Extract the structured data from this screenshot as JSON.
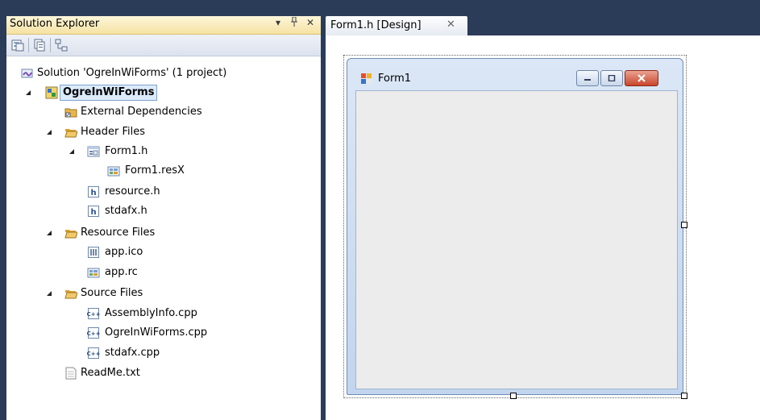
{
  "solution_explorer": {
    "title": "Solution Explorer",
    "title_buttons": [
      "▾",
      "ᵖ",
      "✕"
    ],
    "toolbar": [
      {
        "icon": "properties-icon"
      },
      {
        "icon": "show-all-files-icon"
      },
      {
        "icon": "view-class-diagram-icon"
      }
    ],
    "tree": [
      {
        "label": "Solution 'OgreInWiForms' (1 project)",
        "level": 0,
        "icon": "solution-icon",
        "expander": ""
      },
      {
        "label": "OgreInWiForms",
        "level": 0,
        "icon": "project-icon",
        "expander": "▾",
        "selected": true
      },
      {
        "label": "External Dependencies",
        "level": 1,
        "icon": "folder-icon",
        "expander": ""
      },
      {
        "label": "Header Files",
        "level": 1,
        "icon": "folder-open-icon",
        "expander": "▾"
      },
      {
        "label": "Form1.h",
        "level": 2,
        "icon": "form-icon",
        "expander": "▾"
      },
      {
        "label": "Form1.resX",
        "level": 3,
        "icon": "resx-icon",
        "expander": ""
      },
      {
        "label": "resource.h",
        "level": 2,
        "icon": "header-file-icon",
        "expander": ""
      },
      {
        "label": "stdafx.h",
        "level": 2,
        "icon": "header-file-icon",
        "expander": ""
      },
      {
        "label": "Resource Files",
        "level": 1,
        "icon": "folder-open-icon",
        "expander": "▾"
      },
      {
        "label": "app.ico",
        "level": 2,
        "icon": "ico-file-icon",
        "expander": ""
      },
      {
        "label": "app.rc",
        "level": 2,
        "icon": "rc-file-icon",
        "expander": ""
      },
      {
        "label": "Source Files",
        "level": 1,
        "icon": "folder-open-icon",
        "expander": "▾"
      },
      {
        "label": "AssemblyInfo.cpp",
        "level": 2,
        "icon": "cpp-file-icon",
        "expander": ""
      },
      {
        "label": "OgreInWiForms.cpp",
        "level": 2,
        "icon": "cpp-file-icon",
        "expander": ""
      },
      {
        "label": "stdafx.cpp",
        "level": 2,
        "icon": "cpp-file-icon",
        "expander": ""
      },
      {
        "label": "ReadMe.txt",
        "level": 1,
        "icon": "text-file-icon",
        "expander": ""
      }
    ]
  },
  "document": {
    "tab_label": "Form1.h [Design]",
    "tab_close": "✕",
    "form": {
      "caption": "Form1"
    }
  },
  "colors": {
    "background": "#2b3c59",
    "selection": "#dcebfc",
    "close_button": "#c9462c"
  }
}
